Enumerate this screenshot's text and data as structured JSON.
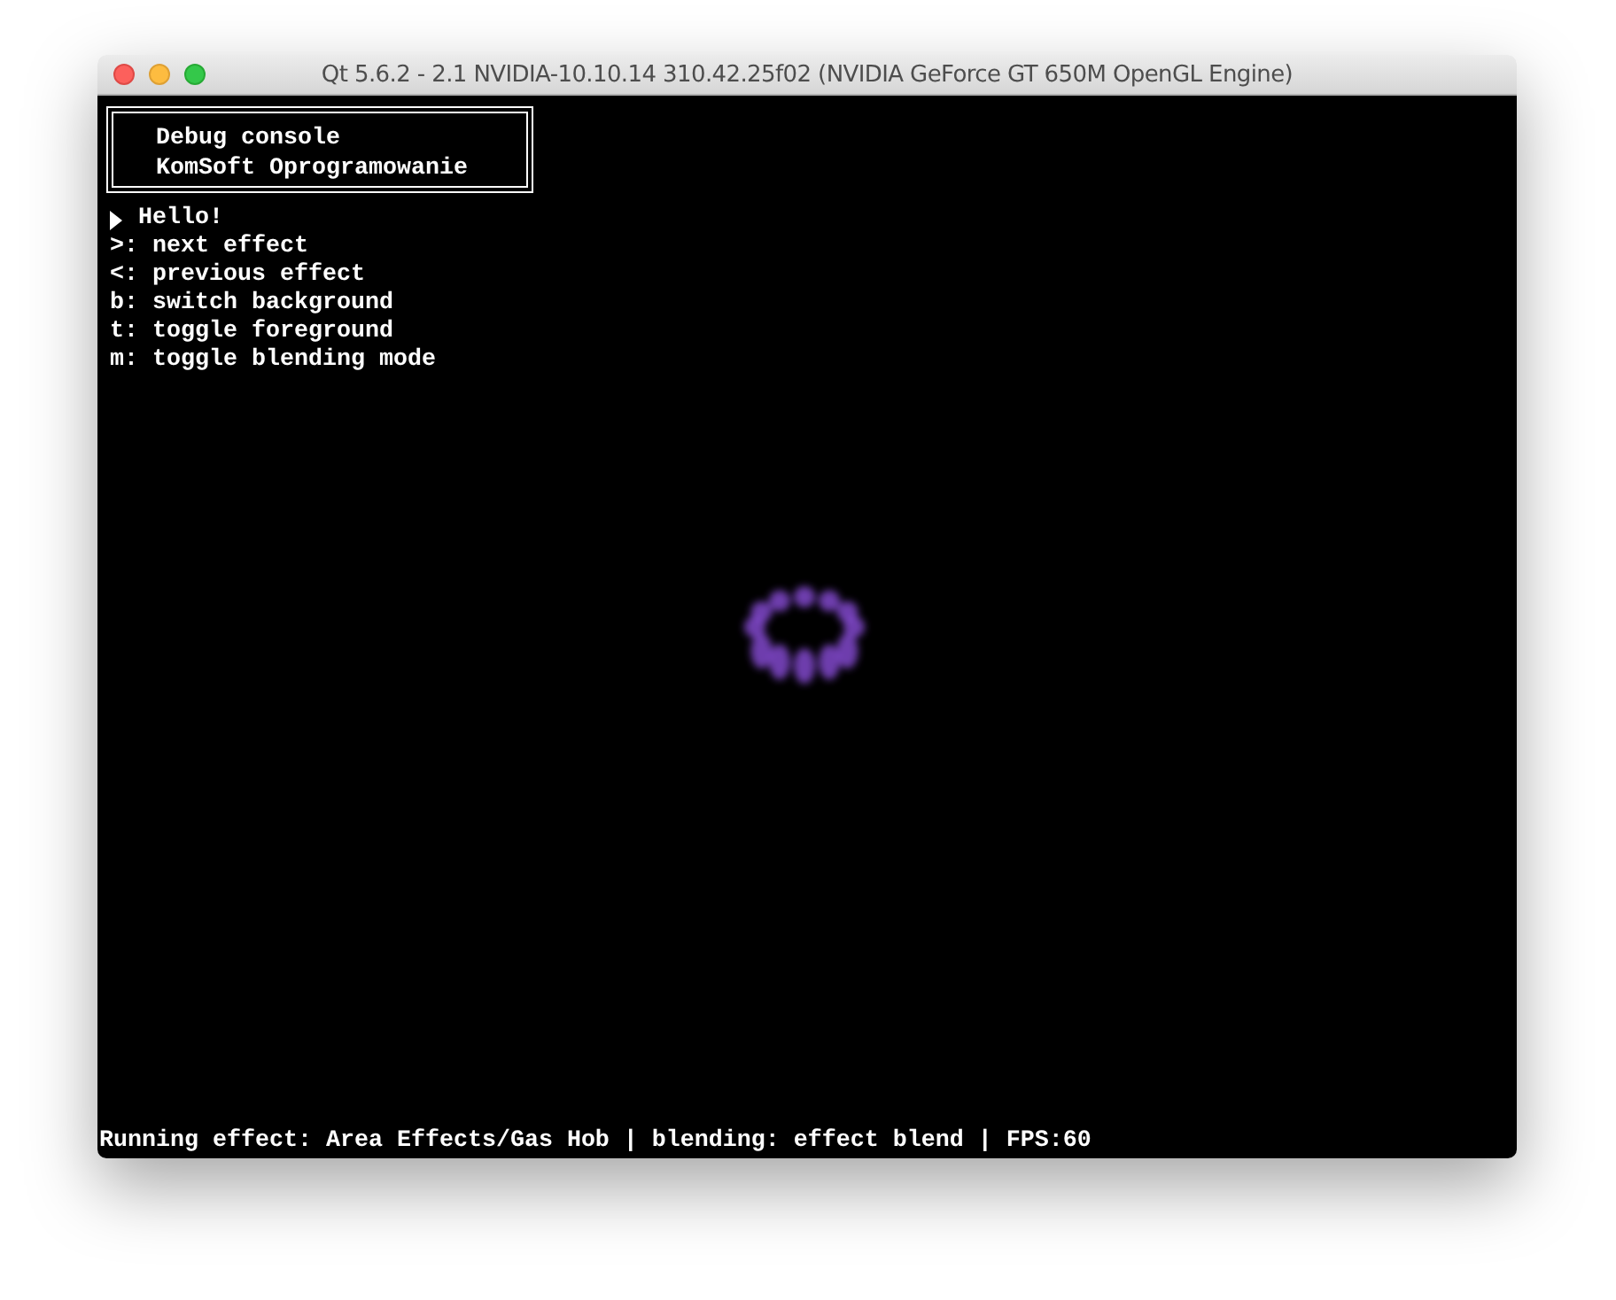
{
  "window": {
    "title": "Qt 5.6.2 - 2.1 NVIDIA-10.10.14 310.42.25f02 (NVIDIA GeForce GT 650M OpenGL Engine)"
  },
  "header": {
    "lines": [
      "Debug console",
      "KomSoft Oprogramowanie"
    ]
  },
  "menu": [
    {
      "text": "Hello!",
      "selected": true
    },
    {
      "text": ">: next effect",
      "selected": false
    },
    {
      "text": "<: previous effect",
      "selected": false
    },
    {
      "text": "b: switch background",
      "selected": false
    },
    {
      "text": "t: toggle foreground",
      "selected": false
    },
    {
      "text": "m: toggle blending mode",
      "selected": false
    }
  ],
  "status_bar": "Running effect: Area Effects/Gas Hob | blending: effect blend | FPS:60"
}
